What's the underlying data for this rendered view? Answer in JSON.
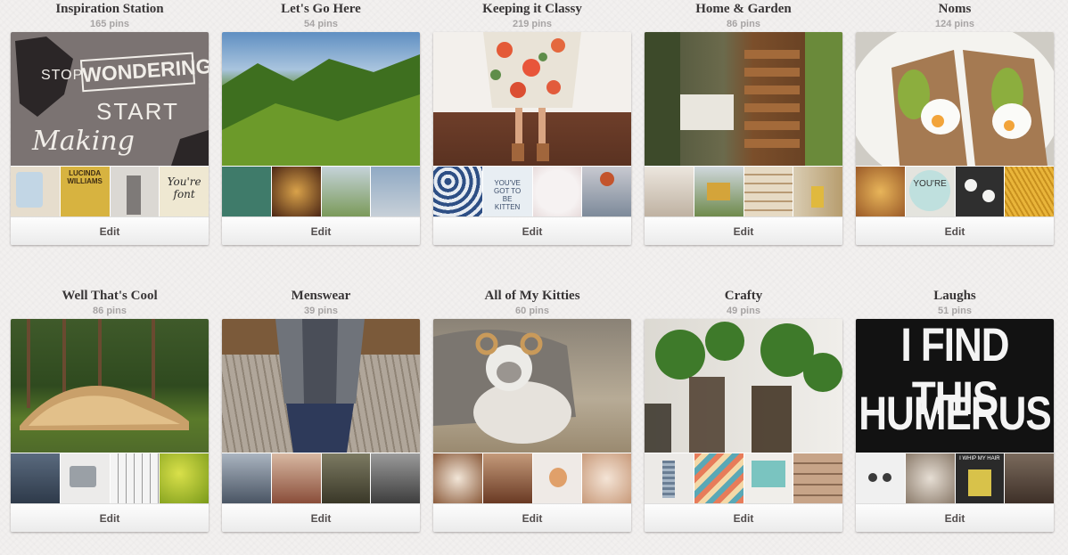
{
  "boards": [
    {
      "id": "inspiration-station",
      "title": "Inspiration Station",
      "count": "165 pins",
      "edit_label": "Edit",
      "cover": {
        "bg": "#7a7170",
        "words": [
          "STOP",
          "WONDERING",
          "START",
          "Making"
        ]
      },
      "thumbs": [
        {
          "bg": "#e7dfd2"
        },
        {
          "bg": "#d8b341",
          "text": "LUCINDA WILLIAMS"
        },
        {
          "bg": "#dcdad5"
        },
        {
          "bg": "#efe9d3",
          "text": "You're font"
        }
      ]
    },
    {
      "id": "lets-go-here",
      "title": "Let's Go Here",
      "count": "54 pins",
      "edit_label": "Edit",
      "cover": {
        "bg": "#4f8a2a"
      },
      "thumbs": [
        {
          "bg": "#3f7b6a"
        },
        {
          "bg": "#6a3b1c"
        },
        {
          "bg": "#8aa56a"
        },
        {
          "bg": "#a4b6c8"
        }
      ]
    },
    {
      "id": "keeping-it-classy",
      "title": "Keeping it Classy",
      "count": "219 pins",
      "edit_label": "Edit",
      "cover": {
        "bg": "#f4f1ee"
      },
      "thumbs": [
        {
          "bg": "#3f5d8e"
        },
        {
          "bg": "#e9eef2",
          "text": "YOU'VE GOT TO BE KITTEN"
        },
        {
          "bg": "#f3ecec"
        },
        {
          "bg": "#7d8a9a"
        }
      ]
    },
    {
      "id": "home-and-garden",
      "title": "Home & Garden",
      "count": "86 pins",
      "edit_label": "Edit",
      "cover": {
        "bg": "#5a4c3c"
      },
      "thumbs": [
        {
          "bg": "#e2d8cc"
        },
        {
          "bg": "#7c8c5e"
        },
        {
          "bg": "#e6dac4"
        },
        {
          "bg": "#c7b48e"
        }
      ]
    },
    {
      "id": "noms",
      "title": "Noms",
      "count": "124 pins",
      "edit_label": "Edit",
      "cover": {
        "bg": "#d9d6cf"
      },
      "thumbs": [
        {
          "bg": "#d8a041"
        },
        {
          "bg": "#e4e4de",
          "text": "YOU'RE"
        },
        {
          "bg": "#2e2e2e"
        },
        {
          "bg": "#e2b43a"
        }
      ]
    },
    {
      "id": "well-thats-cool",
      "title": "Well That's Cool",
      "count": "86 pins",
      "edit_label": "Edit",
      "cover": {
        "bg": "#3e5a2b"
      },
      "thumbs": [
        {
          "bg": "#3b4a5e"
        },
        {
          "bg": "#e9e9ea"
        },
        {
          "bg": "#f3f3f3"
        },
        {
          "bg": "#b6c23a"
        }
      ]
    },
    {
      "id": "menswear",
      "title": "Menswear",
      "count": "39 pins",
      "edit_label": "Edit",
      "cover": {
        "bg": "#8c7b6a"
      },
      "thumbs": [
        {
          "bg": "#4a5564"
        },
        {
          "bg": "#c4a08a"
        },
        {
          "bg": "#4e4a3a"
        },
        {
          "bg": "#5a5a5a"
        }
      ]
    },
    {
      "id": "all-of-my-kitties",
      "title": "All of My Kitties",
      "count": "60 pins",
      "edit_label": "Edit",
      "cover": {
        "bg": "#9a8f83"
      },
      "thumbs": [
        {
          "bg": "#b07d52"
        },
        {
          "bg": "#8a5a3a"
        },
        {
          "bg": "#e9e4e0"
        },
        {
          "bg": "#d9b49a"
        }
      ]
    },
    {
      "id": "crafty",
      "title": "Crafty",
      "count": "49 pins",
      "edit_label": "Edit",
      "cover": {
        "bg": "#e8e6e1"
      },
      "thumbs": [
        {
          "bg": "#eaeaea"
        },
        {
          "bg": "#e77c5a"
        },
        {
          "bg": "#7ac4c0"
        },
        {
          "bg": "#b6927a"
        }
      ]
    },
    {
      "id": "laughs",
      "title": "Laughs",
      "count": "51 pins",
      "edit_label": "Edit",
      "cover": {
        "bg": "#141414",
        "words": [
          "I FIND THIS",
          "HUMERUS"
        ]
      },
      "thumbs": [
        {
          "bg": "#efefef"
        },
        {
          "bg": "#b9aea2"
        },
        {
          "bg": "#2a2a2a",
          "text": "I WHIP MY HAIR"
        },
        {
          "bg": "#5c4a3e"
        }
      ]
    }
  ]
}
